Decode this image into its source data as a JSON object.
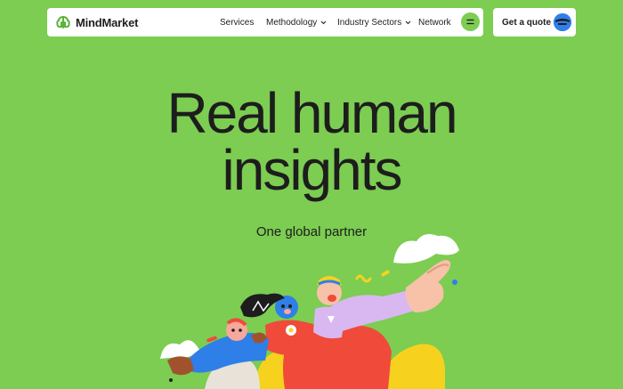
{
  "header": {
    "brand": "MindMarket",
    "nav": [
      {
        "label": "Services",
        "has_dropdown": false
      },
      {
        "label": "Methodology",
        "has_dropdown": true
      },
      {
        "label": "Industry Sectors",
        "has_dropdown": true
      },
      {
        "label": "Network",
        "has_dropdown": false
      }
    ],
    "menu_icon": "equals-icon",
    "cta_label": "Get a quote"
  },
  "hero": {
    "title_line1": "Real human",
    "title_line2": "insights",
    "subtitle": "One global partner"
  },
  "colors": {
    "background": "#7ccd52",
    "nav_bg": "#ffffff",
    "text": "#1d1d1d",
    "accent_blue": "#2f7fe8",
    "accent_red": "#f04a3a",
    "accent_yellow": "#f6d21e",
    "accent_pink": "#f7a89a",
    "accent_lilac": "#d9b8f2"
  },
  "illustration": {
    "icon": "people-crowd-illustration"
  }
}
